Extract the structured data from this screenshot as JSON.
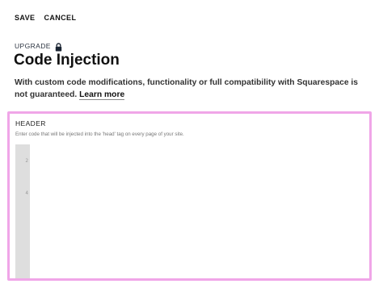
{
  "toolbar": {
    "save_label": "SAVE",
    "cancel_label": "CANCEL"
  },
  "upgrade": {
    "label": "UPGRADE",
    "icon": "lock-icon"
  },
  "page": {
    "title": "Code Injection",
    "description": "With custom code modifications, functionality or full compatibility with Squarespace is not guaranteed.",
    "learn_more": "Learn more"
  },
  "header_section": {
    "label": "HEADER",
    "help_text": "Enter code that will be injected into the 'head' tag on every page of your site.",
    "line_numbers": [
      "2",
      "4"
    ]
  },
  "colors": {
    "focus_border": "#f0a6e8",
    "gutter": "#dedede"
  }
}
